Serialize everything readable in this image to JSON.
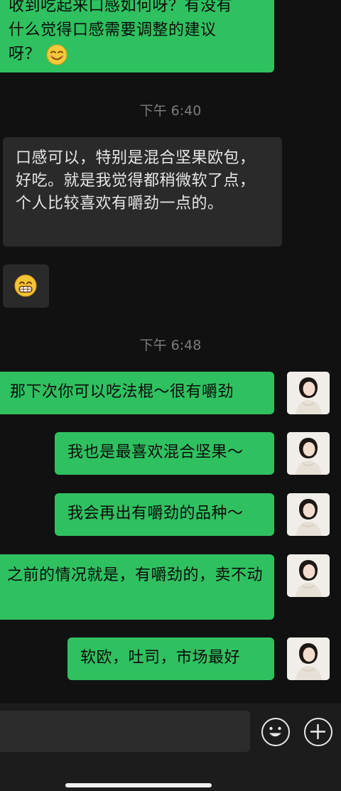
{
  "messages": {
    "m0_line1": "收到吃起来口感如何呀？有没有",
    "m0_line2": "什么觉得口感需要调整的建议",
    "m0_line3": "呀？",
    "time1": "下午 6:40",
    "m1": "口感可以，特别是混合坚果欧包，好吃。就是我觉得都稍微软了点，个人比较喜欢有嚼劲一点的。",
    "time2": "下午 6:48",
    "m3": "那下次你可以吃法棍～很有嚼劲",
    "m4": "我也是最喜欢混合坚果～",
    "m5": "我会再出有嚼劲的品种～",
    "m6": "之前的情况就是，有嚼劲的，卖不动",
    "m7": "软欧，吐司，市场最好"
  },
  "icons": {
    "smile_emoji": "smiling-face-emoji",
    "grin_emoji": "grinning-face-emoji",
    "emoji_button": "smiley-icon",
    "add_button": "plus-icon"
  },
  "colors": {
    "background": "#111111",
    "outgoing_bubble": "#2fc160",
    "incoming_bubble": "#2a2a2a",
    "timestamp": "#7c7c7c"
  },
  "input": {
    "value": "",
    "placeholder": ""
  }
}
